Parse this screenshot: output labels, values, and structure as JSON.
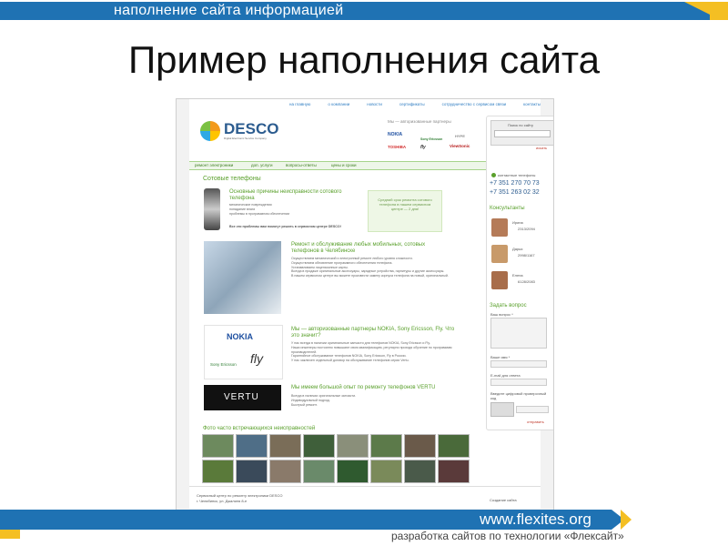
{
  "slide": {
    "top_banner": "наполнение сайта информацией",
    "title": "Пример наполнения сайта",
    "footer_url": "www.flexites.org",
    "footer_tagline": "разработка сайтов по технологии «Флексайт»"
  },
  "site": {
    "top_nav": [
      "на главную",
      "о компании",
      "новости",
      "сертификаты",
      "сотрудничество с сервисом связи",
      "контакты"
    ],
    "logo": "DESCO",
    "logo_sub": "Digital Electronic Service Company",
    "partners_caption": "Мы — авторизованные партнеры",
    "brands": [
      "NOKIA",
      "Sony Ericsson",
      "HYPE",
      "TOSHIBA",
      "fly",
      "ViewSonic"
    ],
    "menu": [
      "ремонт электроники",
      "доп. услуги",
      "вопросы-ответы",
      "цены и сроки"
    ],
    "section_title": "Сотовые телефоны",
    "block1": {
      "title": "Основные причины неисправности сотового телефона",
      "items": [
        "механические повреждения",
        "попадание влаги",
        "проблемы в программном обеспечении"
      ],
      "note": "Все эти проблемы вам помогут решить в сервисном центре DESCO!"
    },
    "promo": "Средний срок ремонта сотового телефона в нашем сервисном центре — 2 дня!",
    "block2": {
      "title": "Ремонт и обслуживание любых мобильных, сотовых телефонов в Челябинске",
      "items": [
        "Осуществляем механический и электронный ремонт любого уровня сложности.",
        "Осуществляем обновление программного обеспечения телефона.",
        "Устанавливаем лицензионные карты.",
        "Всегда в продаже оригинальные аксессуары, зарядные устройства, гарнитуры и другие аксессуары.",
        "В нашем сервисном центре вы можете произвести замену корпуса телефона на новый, оригинальный."
      ]
    },
    "block3": {
      "title": "Мы — авторизованные партнеры NOKIA, Sony Ericsson, Fly. Что это значит?",
      "items": [
        "У нас всегда в наличии оригинальные запчасти для телефонов NOKIA, Sony Ericsson и Fly.",
        "Наши инженеры постоянно повышают свою квалификацию, регулярно проходя обучение по программам производителей.",
        "Гарантийное обслуживание телефонов NOKIA, Sony Ericsson, Fly в России.",
        "У нас заключен отдельный договор на обслуживание телефонов серии Vertu."
      ],
      "logos": [
        "NOKIA",
        "Sony Ericsson",
        "fly"
      ]
    },
    "block4": {
      "title": "Мы имеем большой опыт по ремонту телефонов VERTU",
      "items": [
        "Всегда в наличии оригинальные запчасти.",
        "Индивидуальный подход.",
        "Быстрый ремонт."
      ],
      "logo": "VERTU"
    },
    "photos_title": "Фото часто встречающихся неисправностей",
    "footer_left_1": "Сервисный центр по ремонту электроники DESCO",
    "footer_left_2": "г. Челябинск, ул. Джалиля 8-е",
    "footer_right": "Создание сайта",
    "sidebar": {
      "search_label": "Поиск по сайту",
      "search_link": "искать",
      "phones_label": "контактные телефоны",
      "phone1": "+7 351 270 70 73",
      "phone2": "+7 351 263 02 32",
      "consultants_title": "Консультанты",
      "consultants": [
        {
          "name": "Ирина",
          "id": "2313/2094"
        },
        {
          "name": "Дарья",
          "id": "2998/1167"
        },
        {
          "name": "Елена",
          "id": "6128/2083"
        }
      ],
      "ask_title": "Задать вопрос",
      "q_label": "Ваш вопрос *",
      "name_label": "Ваше имя *",
      "email_label": "E-mail для ответа",
      "captcha_label": "Введите цифровой проверочный код",
      "send_label": "отправить"
    }
  },
  "colors": {
    "banner_blue": "#1f72b3",
    "banner_yellow": "#f4bf23",
    "site_green": "#5aa02c"
  }
}
